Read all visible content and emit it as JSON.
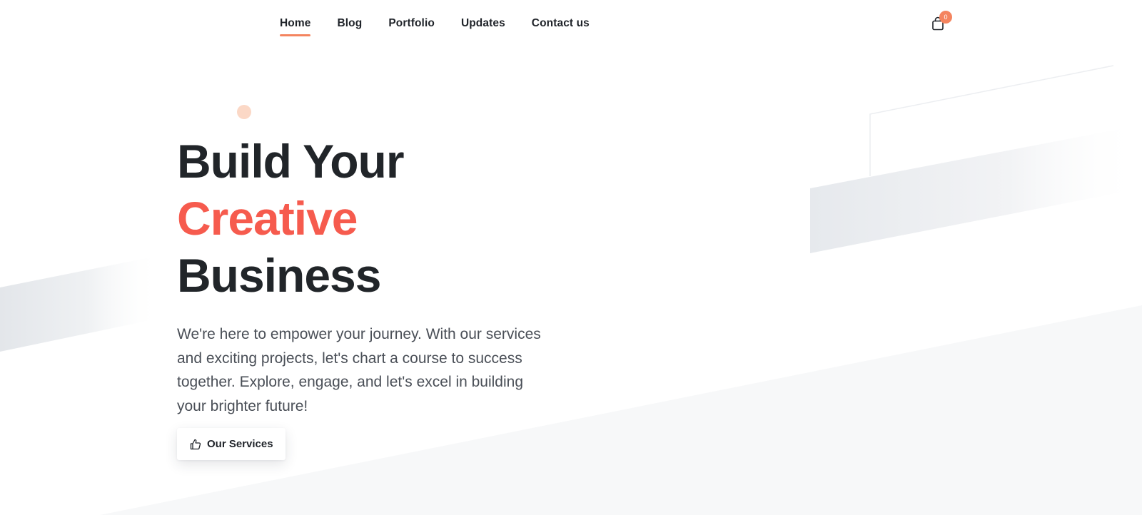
{
  "nav": {
    "items": [
      {
        "label": "Home",
        "active": true
      },
      {
        "label": "Blog",
        "active": false
      },
      {
        "label": "Portfolio",
        "active": false
      },
      {
        "label": "Updates",
        "active": false
      },
      {
        "label": "Contact us",
        "active": false
      }
    ],
    "cart": {
      "icon": "shopping-bag-icon",
      "count": "0"
    }
  },
  "hero": {
    "title_line1": "Build Your",
    "title_line2": "Creative",
    "title_line3": "Business",
    "description": "We're here to empower your journey. With our services and exciting projects, let's chart a course to success together. Explore, engage, and let's excel in building your brighter future!",
    "cta": {
      "label": "Our Services",
      "icon": "thumbs-up-icon"
    }
  },
  "colors": {
    "accent": "#f4845f",
    "title_accent": "#f65b4e",
    "title": "#212529",
    "body_text": "#4a4f57"
  }
}
